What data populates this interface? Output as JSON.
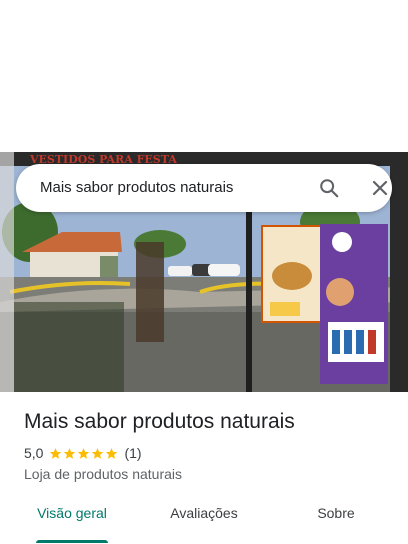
{
  "search": {
    "query": "Mais sabor produtos naturais",
    "search_icon": "search-icon",
    "close_icon": "close-icon"
  },
  "place": {
    "name": "Mais sabor produtos naturais",
    "rating": "5,0",
    "stars": 5,
    "review_count": "(1)",
    "category": "Loja de produtos naturais",
    "star_color": "#fbbc04"
  },
  "tabs": [
    {
      "label": "Visão geral",
      "active": true
    },
    {
      "label": "Avaliações",
      "active": false
    },
    {
      "label": "Sobre",
      "active": false
    }
  ],
  "colors": {
    "accent": "#00796b"
  }
}
